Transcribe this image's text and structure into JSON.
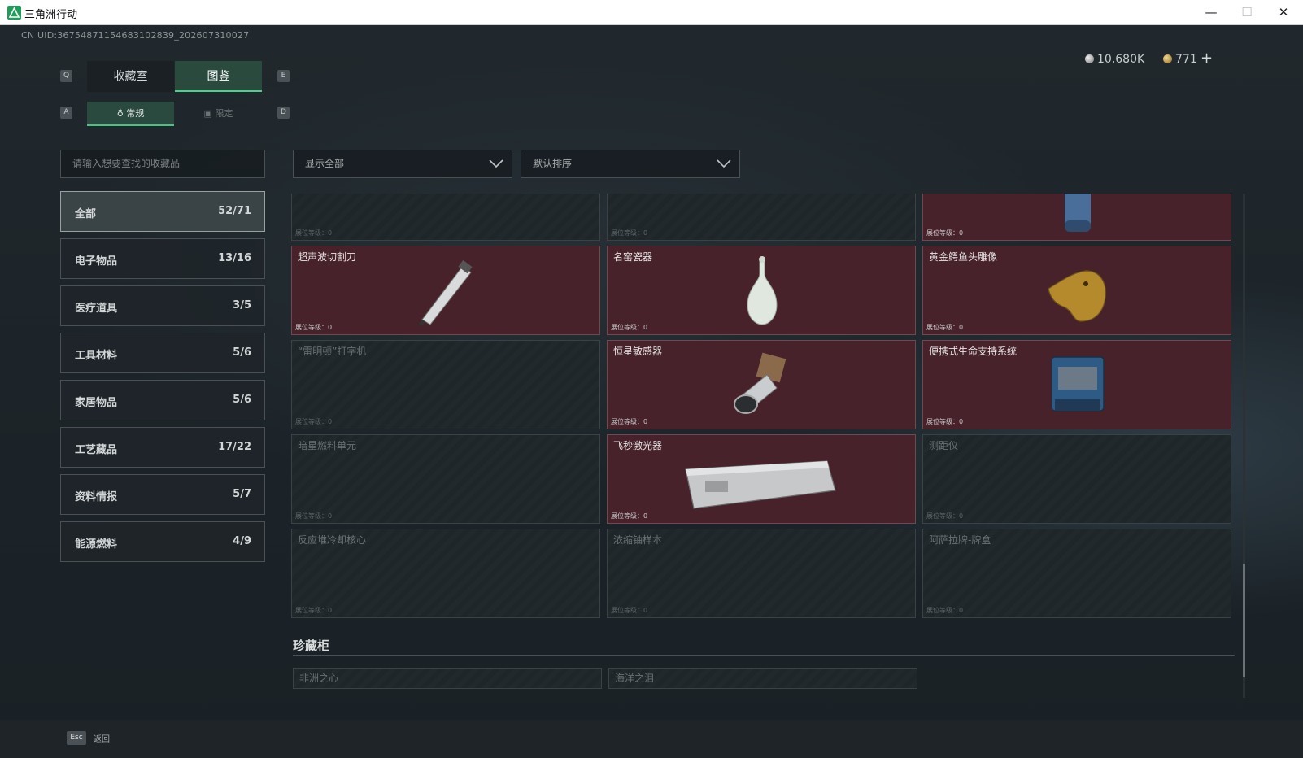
{
  "window": {
    "title": "三角洲行动",
    "min_glyph": "—",
    "max_glyph": "☐",
    "close_glyph": "✕"
  },
  "header": {
    "uid": "CN UID:36754871154683102839_202607310027",
    "currency_a": "10,680K",
    "currency_b": "771",
    "plus": "+"
  },
  "tabs": {
    "key_left": "Q",
    "key_right": "E",
    "main": [
      "收藏室",
      "图鉴"
    ],
    "sub_key_left": "A",
    "sub_key_right": "D",
    "sub": [
      "常规",
      "限定"
    ]
  },
  "search": {
    "placeholder": "请输入想要查找的收藏品"
  },
  "filters": {
    "show": "显示全部",
    "sort": "默认排序"
  },
  "categories": [
    {
      "label": "全部",
      "count": "52/71"
    },
    {
      "label": "电子物品",
      "count": "13/16"
    },
    {
      "label": "医疗道具",
      "count": "3/5"
    },
    {
      "label": "工具材料",
      "count": "5/6"
    },
    {
      "label": "家居物品",
      "count": "5/6"
    },
    {
      "label": "工艺藏品",
      "count": "17/22"
    },
    {
      "label": "资料情报",
      "count": "5/7"
    },
    {
      "label": "能源燃料",
      "count": "4/9"
    }
  ],
  "level_label": "展位等级：0",
  "items": [
    {
      "name": "",
      "icon": "partial-item-icon"
    },
    {
      "name": "",
      "icon": "partial-item-icon"
    },
    {
      "name": "",
      "icon": "gas-canister-icon"
    },
    {
      "name": "超声波切割刀",
      "icon": "cutting-knife-icon"
    },
    {
      "name": "名窑瓷器",
      "icon": "porcelain-vase-icon"
    },
    {
      "name": "黄金鳄鱼头雕像",
      "icon": "gold-crocodile-icon"
    },
    {
      "name": "“雷明顿”打字机",
      "icon": "typewriter-icon"
    },
    {
      "name": "恒星敏感器",
      "icon": "star-sensor-icon"
    },
    {
      "name": "便携式生命支持系统",
      "icon": "life-support-icon"
    },
    {
      "name": "暗星燃料单元",
      "icon": "fuel-cell-icon"
    },
    {
      "name": "飞秒激光器",
      "icon": "laser-device-icon"
    },
    {
      "name": "测距仪",
      "icon": "rangefinder-icon"
    },
    {
      "name": "反应堆冷却核心",
      "icon": "reactor-core-icon"
    },
    {
      "name": "浓缩铀样本",
      "icon": "uranium-sample-icon"
    },
    {
      "name": "阿萨拉牌-牌盒",
      "icon": "card-box-icon"
    }
  ],
  "cabinet": {
    "title": "珍藏柜",
    "items": [
      "非洲之心",
      "海洋之泪"
    ]
  },
  "footer": {
    "esc_key": "Esc",
    "back": "返回"
  }
}
